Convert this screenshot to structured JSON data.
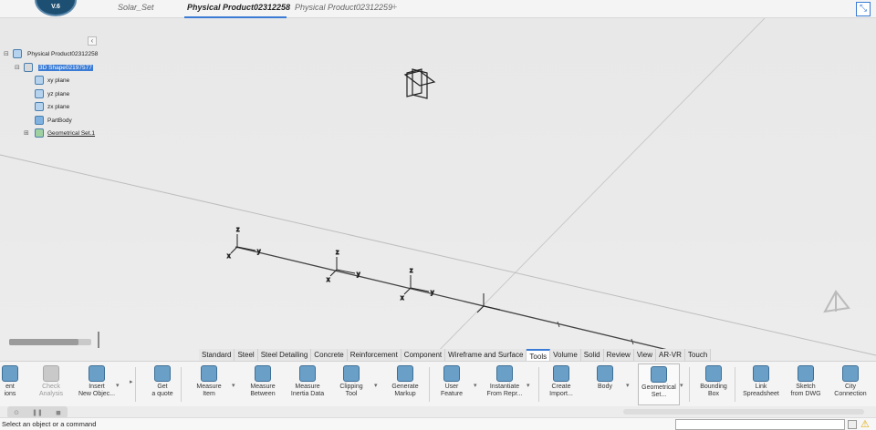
{
  "app": {
    "logo_version": "V.6",
    "colors": {
      "accent": "#3a7bd5",
      "selection": "#3a7bd5",
      "background": "#ececec"
    }
  },
  "tabs": [
    {
      "label": "Solar_Set",
      "active": false
    },
    {
      "label": "Physical Product02312258",
      "active": true
    },
    {
      "label": "Physical Product02312259",
      "active": false
    }
  ],
  "tree": {
    "root": "Physical Product02312258",
    "shape": "3D Shape02197577",
    "items": [
      {
        "label": "xy plane",
        "icon": "plane-icon"
      },
      {
        "label": "yz plane",
        "icon": "plane-icon"
      },
      {
        "label": "zx plane",
        "icon": "plane-icon"
      },
      {
        "label": "PartBody",
        "icon": "partbody-icon"
      },
      {
        "label": "Geometrical Set.1",
        "icon": "geometrical-set-icon"
      }
    ]
  },
  "viewport": {
    "axis_labels": {
      "x": "x",
      "y": "y",
      "z": "z"
    }
  },
  "section_tabs": [
    {
      "label": "Standard",
      "active": false
    },
    {
      "label": "Steel",
      "active": false
    },
    {
      "label": "Steel Detailing",
      "active": false
    },
    {
      "label": "Concrete",
      "active": false
    },
    {
      "label": "Reinforcement",
      "active": false
    },
    {
      "label": "Component",
      "active": false
    },
    {
      "label": "Wireframe and Surface",
      "active": false
    },
    {
      "label": "Tools",
      "active": true
    },
    {
      "label": "Volume",
      "active": false
    },
    {
      "label": "Solid",
      "active": false
    },
    {
      "label": "Review",
      "active": false
    },
    {
      "label": "View",
      "active": false
    },
    {
      "label": "AR-VR",
      "active": false
    },
    {
      "label": "Touch",
      "active": false
    }
  ],
  "tools": [
    {
      "label": "ent\nions",
      "icon": "partial-icon",
      "disabled": false
    },
    {
      "label": "Check\nAnalysis",
      "icon": "check-analysis-icon",
      "disabled": true
    },
    {
      "label": "Insert\nNew Objec...",
      "icon": "insert-new-object-icon",
      "disabled": false
    },
    {
      "label": "Get\na quote",
      "icon": "quote-icon",
      "disabled": false
    },
    {
      "label": "Measure\nItem",
      "icon": "measure-item-icon",
      "disabled": false
    },
    {
      "label": "Measure\nBetween",
      "icon": "measure-between-icon",
      "disabled": false
    },
    {
      "label": "Measure\nInertia Data",
      "icon": "measure-inertia-icon",
      "disabled": false
    },
    {
      "label": "Clipping\nTool",
      "icon": "clipping-tool-icon",
      "disabled": false
    },
    {
      "label": "Generate\nMarkup",
      "icon": "markup-icon",
      "disabled": false
    },
    {
      "label": "User\nFeature",
      "icon": "user-feature-icon",
      "disabled": false
    },
    {
      "label": "Instantiate\nFrom Repr...",
      "icon": "instantiate-icon",
      "disabled": false
    },
    {
      "label": "Create\nImport...",
      "icon": "create-import-icon",
      "disabled": false
    },
    {
      "label": "Body",
      "icon": "body-icon",
      "disabled": false
    },
    {
      "label": "Geometrical\nSet...",
      "icon": "geometrical-set-icon",
      "disabled": false
    },
    {
      "label": "Bounding\nBox",
      "icon": "bounding-box-icon",
      "disabled": false
    },
    {
      "label": "Link\nSpreadsheet",
      "icon": "spreadsheet-icon",
      "disabled": false
    },
    {
      "label": "Sketch\nfrom DWG",
      "icon": "sketch-dwg-icon",
      "disabled": false
    },
    {
      "label": "City\nConnection",
      "icon": "city-connection-icon",
      "disabled": false
    }
  ],
  "status": {
    "message": "Select an object or a command",
    "command_value": ""
  }
}
